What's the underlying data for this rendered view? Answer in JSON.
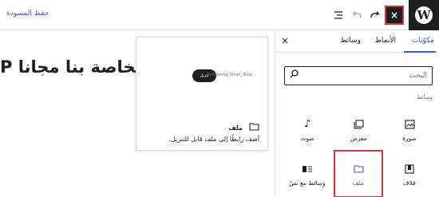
{
  "toolbar": {
    "wp_logo": "W",
    "close_label": "×",
    "save_draft": "حفظ المسودة",
    "icons": [
      "list-view-icon",
      "undo-icon",
      "redo-icon"
    ]
  },
  "sidebar": {
    "tabs": [
      {
        "label": "مكوّنات"
      },
      {
        "label": "الأنماط"
      },
      {
        "label": "وسائط"
      }
    ],
    "close": "×",
    "search_placeholder": "البحث",
    "category": "وسائط",
    "blocks": [
      {
        "label": "صورة",
        "icon": "▧"
      },
      {
        "label": "معرض",
        "icon": "▤"
      },
      {
        "label": "صوت",
        "icon": "♪"
      },
      {
        "label": "غلاف",
        "icon": "◧"
      },
      {
        "label": "ملف",
        "icon": "🗀"
      },
      {
        "label": "وسائط مع نصّ",
        "icon": "▮≡"
      }
    ]
  },
  "canvas": {
    "heading": "الخاصة بنا مجانا P"
  },
  "preview": {
    "filename": "Armstrong_Sinan_Step",
    "button": "تنزيل",
    "title": "ملف",
    "description": "أضف رابطًا إلى ملف قابل للتنزيل."
  },
  "colors": {
    "accent": "#3858e9",
    "highlight": "#d63638",
    "dark": "#1e1e1e"
  }
}
